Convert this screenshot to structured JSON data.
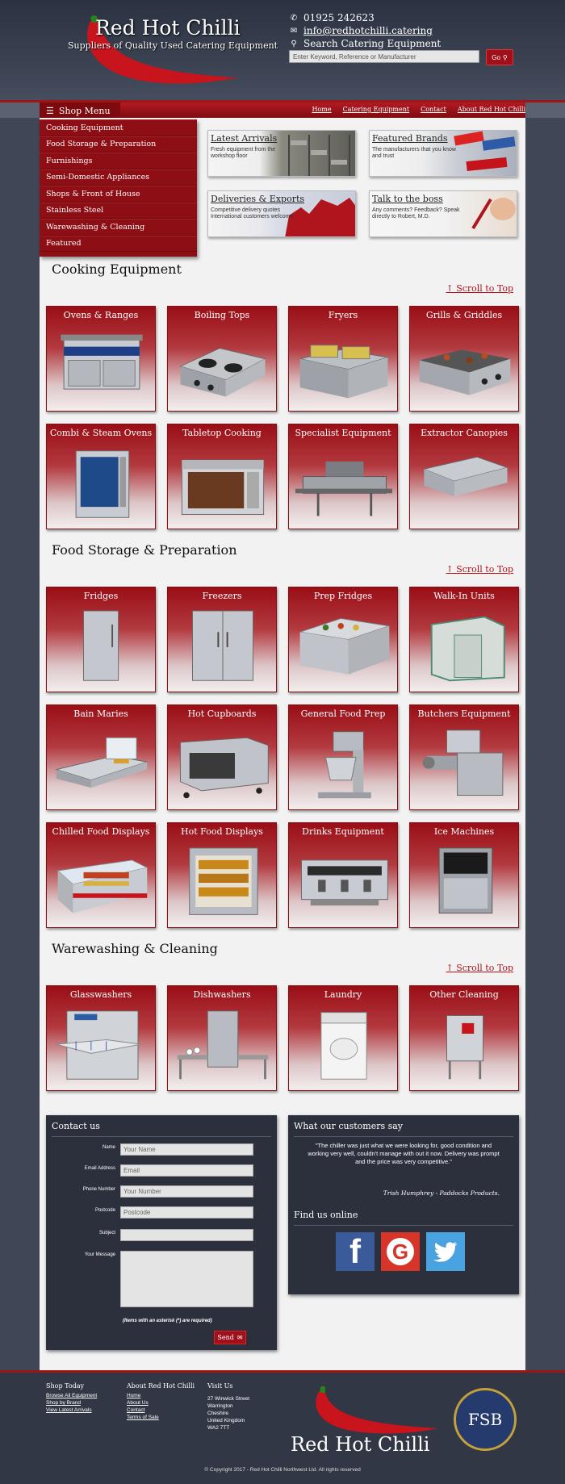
{
  "header": {
    "title": "Red Hot Chilli",
    "subtitle": "Suppliers of Quality Used Catering Equipment",
    "phone": "01925 242623",
    "email": "info@redhotchilli.catering",
    "search_label": "Search Catering Equipment",
    "search_placeholder": "Enter Keyword, Reference or Manufacturer",
    "search_button": "Go"
  },
  "nav": {
    "shop_menu": "Shop Menu",
    "links": [
      "Home",
      "Catering Equipment",
      "Contact",
      "About Red Hot Chilli"
    ]
  },
  "menu": [
    "Cooking Equipment",
    "Food Storage & Preparation",
    "Furnishings",
    "Semi-Domestic Appliances",
    "Shops & Front of House",
    "Stainless Steel",
    "Warewashing & Cleaning",
    "Featured"
  ],
  "promos": [
    {
      "title": "Latest Arrivals",
      "desc": "Fresh equipment from the workshop floor"
    },
    {
      "title": "Featured Brands",
      "desc": "The manufacturers that you know and trust"
    },
    {
      "title": "Deliveries & Exports",
      "desc": "Competitive delivery quotes International customers welcome"
    },
    {
      "title": "Talk to the boss",
      "desc": "Any comments? Feedback? Speak directly to Robert, M.D."
    }
  ],
  "scroll_top": "↑ Scroll to Top",
  "sections": [
    {
      "title": "Cooking Equipment",
      "items": [
        "Ovens & Ranges",
        "Boiling Tops",
        "Fryers",
        "Grills & Griddles",
        "Combi & Steam Ovens",
        "Tabletop Cooking",
        "Specialist Equipment",
        "Extractor Canopies"
      ]
    },
    {
      "title": "Food Storage & Preparation",
      "items": [
        "Fridges",
        "Freezers",
        "Prep Fridges",
        "Walk-In Units",
        "Bain Maries",
        "Hot Cupboards",
        "General Food Prep",
        "Butchers Equipment",
        "Chilled Food Displays",
        "Hot Food Displays",
        "Drinks Equipment",
        "Ice Machines"
      ]
    },
    {
      "title": "Warewashing & Cleaning",
      "items": [
        "Glasswashers",
        "Dishwashers",
        "Laundry",
        "Other Cleaning"
      ]
    }
  ],
  "contact": {
    "title": "Contact us",
    "fields": [
      {
        "label": "Name",
        "placeholder": "Your Name"
      },
      {
        "label": "Email Address",
        "placeholder": "Email"
      },
      {
        "label": "Phone Number",
        "placeholder": "Your Number"
      },
      {
        "label": "Postcode",
        "placeholder": "Postcode"
      },
      {
        "label": "Subject",
        "placeholder": ""
      },
      {
        "label": "Your Message",
        "placeholder": ""
      }
    ],
    "note": "(Items with an asterisk (*) are required)",
    "send": "Send"
  },
  "testimonial": {
    "title": "What our customers say",
    "quote": "\"The chiller was just what we were looking for, good condition and working very well, couldn't manage with out it now. Delivery was prompt and the price was very competitive.\"",
    "author": "Trish Humphrey - Paddocks Products.",
    "find_us": "Find us online"
  },
  "footer": {
    "shop_title": "Shop Today",
    "shop_links": [
      "Browse All Equipment",
      "Shop by Brand",
      "View Latest Arrivals"
    ],
    "about_title": "About Red Hot Chilli",
    "about_links": [
      "Home",
      "About Us",
      "Contact",
      "Terms of Sale"
    ],
    "visit_title": "Visit Us",
    "address": [
      "27 Winwick Street",
      "Warrington",
      "Cheshire",
      "United Kingdom",
      "WA2 7TT"
    ],
    "logo": "Red Hot Chilli",
    "badge": "FSB",
    "copyright": "© Copyright 2017 - Red Hot Chilli Northwest Ltd. All rights reserved"
  },
  "colors": {
    "brand_red": "#9e1515",
    "panel": "#2b303c",
    "background": "#3f4655"
  }
}
